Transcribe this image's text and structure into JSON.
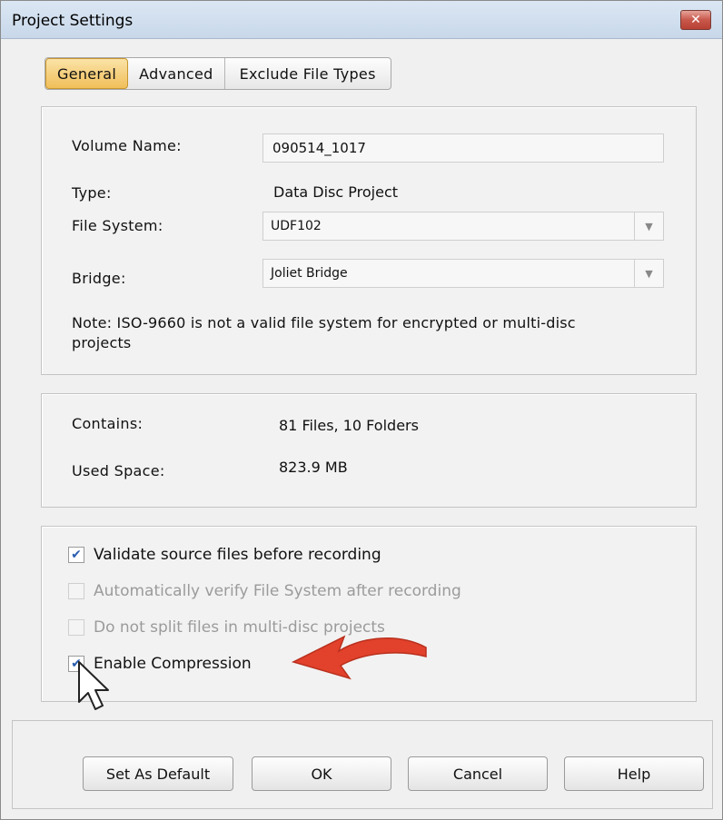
{
  "window": {
    "title": "Project Settings",
    "close_glyph": "✕"
  },
  "tabs": [
    {
      "label": "General",
      "active": true
    },
    {
      "label": "Advanced",
      "active": false
    },
    {
      "label": "Exclude File Types",
      "active": false
    }
  ],
  "general": {
    "volume_name_label": "Volume Name:",
    "volume_name_value": "090514_1017",
    "type_label": "Type:",
    "type_value": "Data Disc Project",
    "file_system_label": "File System:",
    "file_system_value": "UDF102",
    "bridge_label": "Bridge:",
    "bridge_value": "Joliet Bridge",
    "note": "Note: ISO-9660 is not a valid file system for encrypted or multi-disc projects"
  },
  "info": {
    "contains_label": "Contains:",
    "contains_value": "81 Files, 10 Folders",
    "used_space_label": "Used Space:",
    "used_space_value": "823.9 MB"
  },
  "options": [
    {
      "label": "Validate source files before recording",
      "checked": true,
      "enabled": true
    },
    {
      "label": "Automatically verify File System after recording",
      "checked": false,
      "enabled": false
    },
    {
      "label": "Do not split files in multi-disc projects",
      "checked": false,
      "enabled": false
    },
    {
      "label": "Enable Compression",
      "checked": true,
      "enabled": true
    }
  ],
  "buttons": {
    "set_default": "Set As Default",
    "ok": "OK",
    "cancel": "Cancel",
    "help": "Help"
  },
  "icons": {
    "check": "✔",
    "dropdown": "▼"
  },
  "colors": {
    "active_tab": "#f0bf59",
    "annotation_arrow": "#e2412b",
    "checkmark": "#2a5db0"
  }
}
